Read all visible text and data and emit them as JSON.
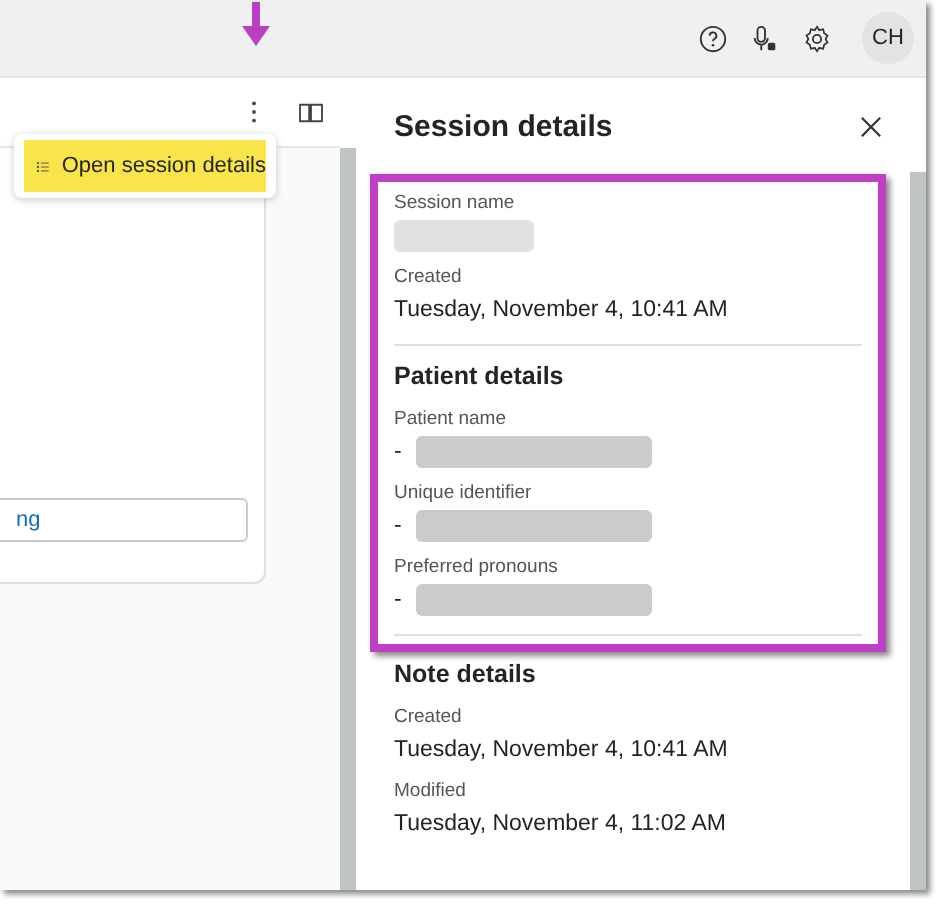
{
  "top_bar": {
    "avatar": "CH"
  },
  "left_pane": {
    "menu_item": {
      "label": "Open session details",
      "highlighted": true
    },
    "field_value": "ng"
  },
  "details_panel": {
    "title": "Session details",
    "sections": [
      {
        "highlighted": true,
        "fields": [
          {
            "label": "Session name",
            "redacted": true
          },
          {
            "label": "Created",
            "value": "Tuesday, November 4, 10:41 AM"
          }
        ]
      },
      {
        "heading": "Patient details",
        "highlighted": true,
        "fields": [
          {
            "label": "Patient name",
            "value": "-",
            "redacted": true
          },
          {
            "label": "Unique identifier",
            "value": "-",
            "redacted": true
          },
          {
            "label": "Preferred pronouns",
            "value": "-",
            "redacted": true
          }
        ]
      },
      {
        "heading": "Note details",
        "fields": [
          {
            "label": "Created",
            "value": "Tuesday, November 4, 10:41 AM"
          },
          {
            "label": "Modified",
            "value": "Tuesday, November 4, 11:02 AM"
          }
        ]
      }
    ]
  }
}
